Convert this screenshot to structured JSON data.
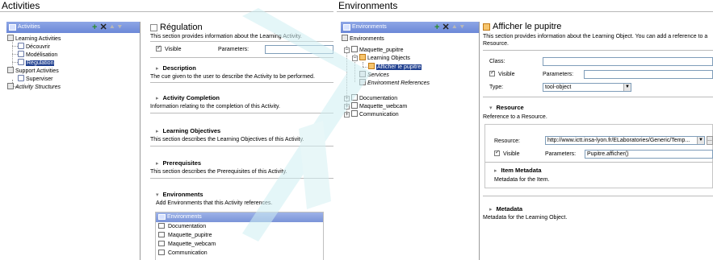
{
  "left": {
    "title": "Activities",
    "tree_header": "Activities",
    "toolbar": {
      "add": "+",
      "remove": "✕",
      "up": "⯅",
      "down": "⯆"
    },
    "tree": [
      {
        "label": "Learning Activities",
        "icon": "activity-icon"
      },
      {
        "label": "Découvrir",
        "icon": "leaf-icon"
      },
      {
        "label": "Modélisation",
        "icon": "leaf-icon"
      },
      {
        "label": "Régulation",
        "icon": "leaf-icon",
        "selected": true
      },
      {
        "label": "Support Activities",
        "icon": "support-icon"
      },
      {
        "label": "Superviser",
        "icon": "leaf-icon"
      },
      {
        "label": "Activity Structures",
        "icon": "structure-icon",
        "italic": true
      }
    ],
    "detail": {
      "title": "Régulation",
      "intro": "This section provides information about the Learning Activity.",
      "visible_label": "Visible",
      "parameters_label": "Parameters:",
      "sections": [
        {
          "title": "Description",
          "text": "The cue given to the user to describe the Activity to be performed."
        },
        {
          "title": "Activity Completion",
          "text": "Information relating to the completion of this Activity."
        },
        {
          "title": "Learning Objectives",
          "text": "This section describes the Learning Objectives of this Activity."
        },
        {
          "title": "Prerequisites",
          "text": "This section describes the Prerequisites of this Activity."
        },
        {
          "title": "Environments",
          "text": "Add Environments that this Activity references."
        }
      ],
      "env_list_header": "Environments",
      "env_list": [
        "Documentation",
        "Maquette_pupitre",
        "Maquette_webcam",
        "Communication"
      ]
    }
  },
  "right": {
    "title": "Environments",
    "tree_header": "Environments",
    "toolbar": {
      "add": "+",
      "remove": "✕",
      "up": "⯅",
      "down": "⯆"
    },
    "tree": [
      {
        "label": "Environments",
        "icon": "environments-icon"
      },
      {
        "label": "Maquette_pupitre",
        "icon": "box-icon"
      },
      {
        "label": "Learning Objects",
        "icon": "objects-icon"
      },
      {
        "label": "Afficher le pupitre",
        "icon": "object-icon",
        "selected": true
      },
      {
        "label": "Services",
        "icon": "services-icon",
        "italic": true
      },
      {
        "label": "Environment References",
        "icon": "references-icon",
        "italic": true
      },
      {
        "label": "Documentation",
        "icon": "box-icon"
      },
      {
        "label": "Maquette_webcam",
        "icon": "box-icon"
      },
      {
        "label": "Communication",
        "icon": "box-icon"
      }
    ],
    "detail": {
      "title": "Afficher le pupitre",
      "intro": "This section provides information about the Learning Object. You can add a reference to a Resource.",
      "class_label": "Class:",
      "visible_label": "Visible",
      "parameters_label": "Parameters:",
      "type_label": "Type:",
      "type_value": "tool-object",
      "resource_section": "Resource",
      "resource_text": "Reference to a Resource.",
      "resource_label": "Resource:",
      "resource_value": "http://www.ictt.insa-lyon.fr/ELaboratories/Generic/Temp...",
      "res_visible_label": "Visible",
      "res_parameters_label": "Parameters:",
      "res_parameters_value": "Pupitre.afficher()",
      "item_metadata_section": "Item Metadata",
      "item_metadata_text": "Metadata for the Item.",
      "metadata_section": "Metadata",
      "metadata_text": "Metadata for the Learning Object."
    }
  },
  "colors": {
    "header_blue": "#6c88d8",
    "selection": "#1f3f8f",
    "add_green": "#2a8b2a"
  }
}
